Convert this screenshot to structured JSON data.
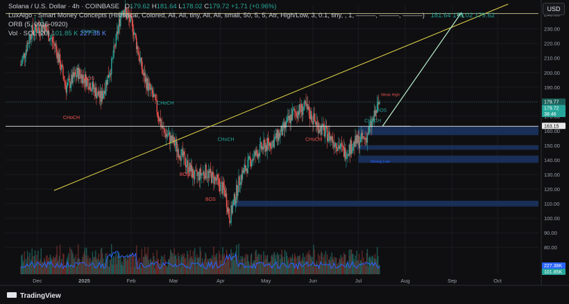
{
  "header": {
    "line1_title": "Solana / U.S. Dollar · 4h · COINBASE",
    "line1_o": "O",
    "line1_o_val": "179.62",
    "line1_h": "H",
    "line1_h_val": "181.64",
    "line1_l": "L",
    "line1_l_val": "178.02",
    "line1_c": "C",
    "line1_c_val": "179.72",
    "line1_change": "+1.71 (+0.96%)",
    "line2": "LuxAlgo - Smart Money Concepts (Historical, Colored, All, All, tiny, All, All, small, 50, 5, 5, Atr, High/Low, 3, 0.1, tiny, , 1, ———, ———, ———)",
    "line2_vals": "181.64  178.02  179.62",
    "line3": "ORB (5, 0915-0920)",
    "line4_prefix": "Vol · SOL (20)",
    "line4_v1": "101.85 K",
    "line4_v2": "227.38 K"
  },
  "currency_button": "USD",
  "brand": "TradingView",
  "chart_data": {
    "type": "candlestick",
    "symbol": "SOL/USD",
    "timeframe": "4h",
    "x_labels": [
      "Dec",
      "2025",
      "Feb",
      "Mar",
      "Apr",
      "May",
      "Jun",
      "Jul",
      "Aug",
      "Sep",
      "Oct"
    ],
    "y_ticks": [
      80,
      90,
      100,
      110,
      120,
      130,
      140,
      150,
      160,
      170,
      180,
      190,
      200,
      210,
      220,
      230,
      240
    ],
    "ylim": [
      72,
      246
    ],
    "price_path_dates": [
      "2024-11-20",
      "2024-11-27",
      "2024-12-05",
      "2024-12-13",
      "2024-12-20",
      "2024-12-28",
      "2025-01-05",
      "2025-01-12",
      "2025-01-19",
      "2025-01-26",
      "2025-02-02",
      "2025-02-09",
      "2025-02-16",
      "2025-02-22",
      "2025-03-01",
      "2025-03-08",
      "2025-03-15",
      "2025-03-22",
      "2025-03-29",
      "2025-04-04",
      "2025-04-07",
      "2025-04-14",
      "2025-04-21",
      "2025-04-28",
      "2025-05-05",
      "2025-05-12",
      "2025-05-19",
      "2025-05-27",
      "2025-06-04",
      "2025-06-11",
      "2025-06-18",
      "2025-06-22",
      "2025-06-29",
      "2025-07-06",
      "2025-07-11",
      "2025-07-15"
    ],
    "price_path_values": [
      205,
      228,
      232,
      218,
      190,
      200,
      192,
      182,
      205,
      245,
      232,
      198,
      182,
      160,
      152,
      140,
      128,
      132,
      126,
      118,
      100,
      128,
      140,
      148,
      152,
      160,
      172,
      176,
      164,
      157,
      150,
      145,
      152,
      155,
      168,
      179.72
    ],
    "levels": [
      {
        "label": "163.15",
        "price": 163.15,
        "color": "#ffffff"
      },
      {
        "label": "179.77",
        "price": 179.77,
        "color": "#2aa198"
      },
      {
        "label": "179.72",
        "price": 179.72,
        "color": "#26a69a"
      },
      {
        "label": "38:46",
        "price": 176.6,
        "color": "#26a69a"
      },
      {
        "label": "227.38K",
        "volume": 227380,
        "color": "#2962ff"
      },
      {
        "label": "101.85K",
        "volume": 101850,
        "color": "#26a69a"
      }
    ],
    "structure_labels": [
      {
        "text": "CHoCH",
        "color": "#ef5350"
      },
      {
        "text": "CHoCH",
        "color": "#26a69a"
      },
      {
        "text": "BOS",
        "color": "#ef5350"
      },
      {
        "text": "BOS",
        "color": "#ef5350"
      },
      {
        "text": "CHoCH",
        "color": "#26a69a"
      },
      {
        "text": "CHoCH",
        "color": "#ef5350"
      },
      {
        "text": "CHoCH",
        "color": "#26a69a"
      },
      {
        "text": "BOS",
        "color": "#26a69a"
      },
      {
        "text": "BOS",
        "color": "#ef5350"
      },
      {
        "text": "CHoCH",
        "color": "#26a69a"
      },
      {
        "text": "Weak High",
        "color": "#ef5350"
      },
      {
        "text": "Strong Low",
        "color": "#2962ff"
      }
    ],
    "trendline": {
      "from": [
        "2024-12-12",
        119
      ],
      "to": [
        "2025-10-08",
        247
      ],
      "color": "#e6d84a"
    },
    "projection_arrow": {
      "from": [
        "2025-07-17",
        163.15
      ],
      "to": [
        "2025-09-07",
        241
      ],
      "color": "#b9f0d0"
    },
    "demand_zones": [
      {
        "from_date": "2025-07-01",
        "top": 163,
        "bottom": 157
      },
      {
        "from_date": "2025-06-30",
        "top": 150,
        "bottom": 147
      },
      {
        "from_date": "2025-07-01",
        "top": 143,
        "bottom": 138
      },
      {
        "from_date": "2025-04-09",
        "top": 112,
        "bottom": 108
      }
    ],
    "volume_max_k": 800
  }
}
